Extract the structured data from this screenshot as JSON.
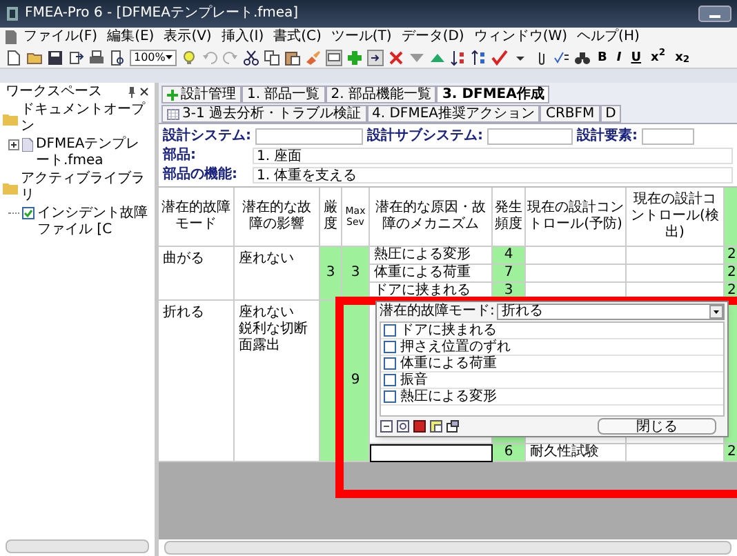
{
  "window": {
    "title": "FMEA-Pro 6 - [DFMEAテンプレート.fmea]"
  },
  "menu": [
    "ファイル(F)",
    "編集(E)",
    "表示(V)",
    "挿入(I)",
    "書式(C)",
    "ツール(T)",
    "データ(D)",
    "ウィンドウ(W)",
    "ヘルプ(H)"
  ],
  "toolbar": {
    "zoom": "100%",
    "format_buttons": [
      "B",
      "I",
      "U",
      "x$^{2}$",
      "x$_{2}$"
    ]
  },
  "workspace": {
    "title": "ワークスペース",
    "tree": [
      {
        "label": "ドキュメントオープン",
        "children": [
          {
            "label": "DFMEAテンプレート.fmea",
            "expanded": false
          }
        ]
      },
      {
        "label": "アクティブライブラリ",
        "children": [
          {
            "label": "インシデント故障ファイル [C",
            "checked": true
          }
        ]
      }
    ]
  },
  "tabs": [
    {
      "label": "設計管理",
      "selected": false
    },
    {
      "label": "1. 部品一覧",
      "selected": false
    },
    {
      "label": "2. 部品機能一覧",
      "selected": false
    },
    {
      "label": "3. DFMEA作成",
      "selected": true
    },
    {
      "label": "3-1 過去分析・トラブル検証",
      "selected": false
    },
    {
      "label": "4. DFMEA推奨アクション",
      "selected": false
    },
    {
      "label": "CRBFM",
      "selected": false
    },
    {
      "label": "D",
      "selected": false
    }
  ],
  "fields": [
    {
      "label": "設計システム:"
    },
    {
      "label": "設計サブシステム:"
    },
    {
      "label": "設計要素:"
    },
    {
      "label": "部品:",
      "value": "1. 座面"
    },
    {
      "label": "部品の機能:",
      "value": "1. 体重を支える"
    }
  ],
  "table": {
    "columns": [
      "潜在的故障モード",
      "潜在的な故障の影響",
      "厳度",
      "Max Sev",
      "潜在的な原因・故障のメカニズム",
      "発生頻度",
      "現在の設計コントロール(予防)",
      "現在の設計コントロール(検出)"
    ],
    "rows": [
      {
        "failure_mode": "曲がる",
        "effects": [
          "座れない"
        ],
        "severity": "3",
        "max_sev": "3",
        "causes": [
          {
            "editing": false,
            "cause": "熱圧による変形",
            "occurrence": "4",
            "column_9": "2"
          },
          {
            "editing": false,
            "cause": "体重による荷重",
            "occurrence": "7",
            "column_9": "2"
          },
          {
            "editing": false,
            "cause": "ドアに挟まれる",
            "occurrence": "3",
            "column_9": "2"
          }
        ]
      },
      {
        "failure_mode": "折れる",
        "effects": [
          "座れない",
          "鋭利な切断面露出"
        ],
        "max_sev": "9",
        "causes": [
          {
            "editing": true,
            "occurrence": "6",
            "prevention": "耐久性試験",
            "column_9": "2"
          }
        ]
      }
    ]
  },
  "popup": {
    "label": "潜在的故障モード:",
    "value": "折れる",
    "options": [
      {
        "label": "ドアに挟まれる",
        "checked": false
      },
      {
        "label": "押さえ位置のずれ",
        "checked": false
      },
      {
        "label": "体重による荷重",
        "checked": false
      },
      {
        "label": "振音",
        "checked": false
      },
      {
        "label": "熱圧による変形",
        "checked": false
      }
    ],
    "close_button": "閉じる"
  }
}
